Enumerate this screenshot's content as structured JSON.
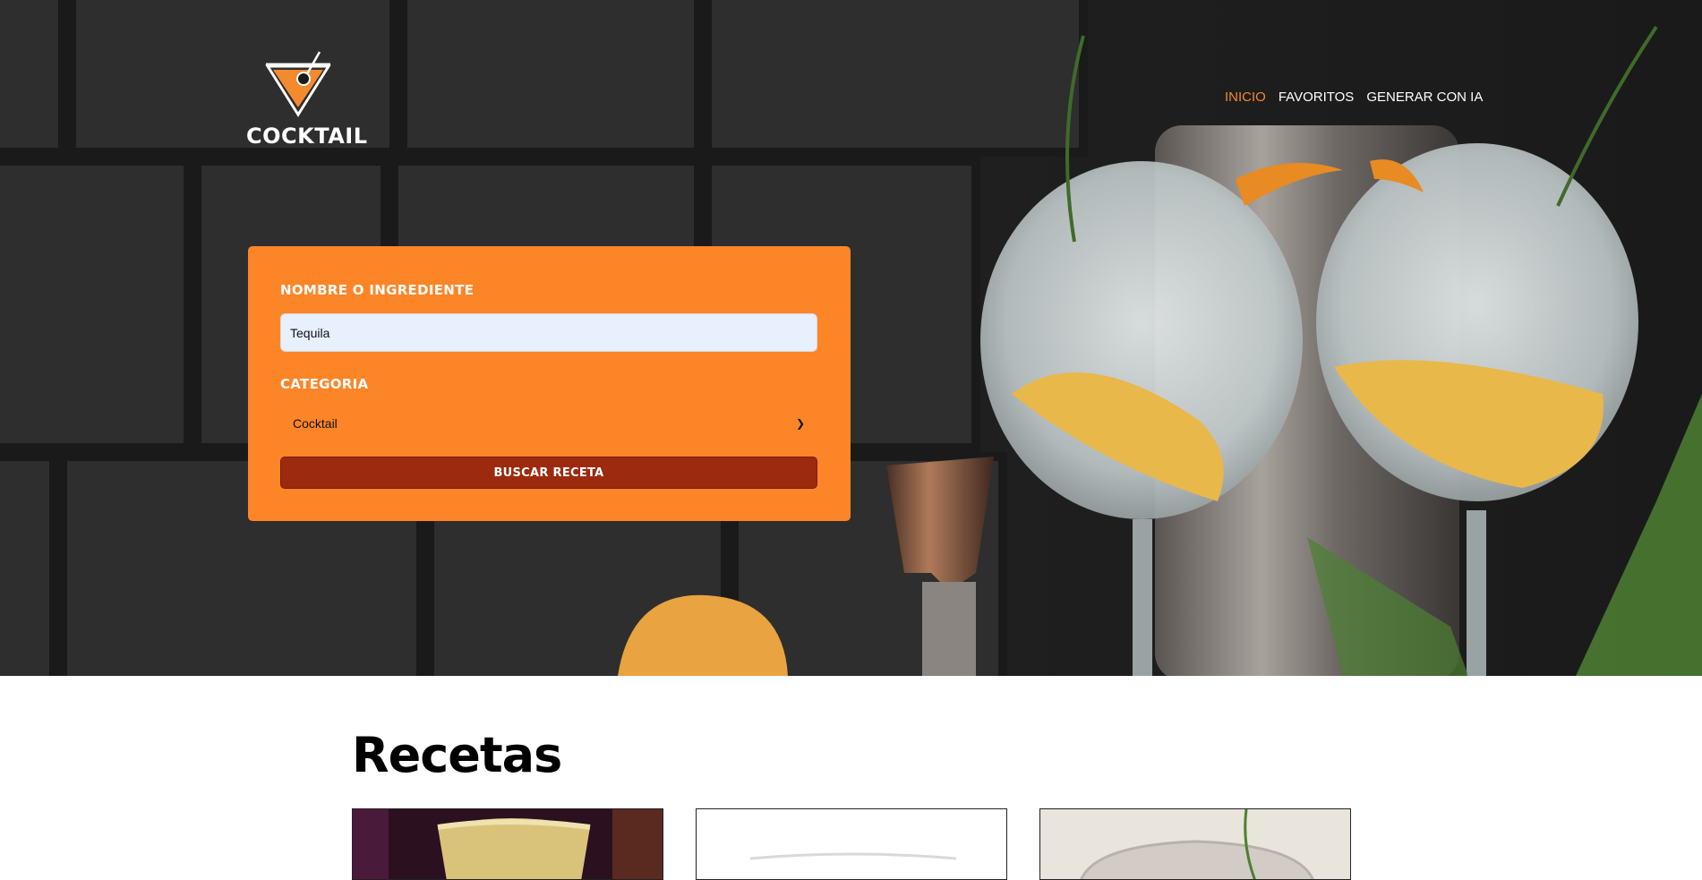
{
  "header": {
    "logo_text": "COCKTAIL",
    "nav": [
      {
        "label": "INICIO",
        "active": true
      },
      {
        "label": "FAVORITOS",
        "active": false
      },
      {
        "label": "GENERAR CON IA",
        "active": false
      }
    ]
  },
  "search": {
    "name_label": "NOMBRE O INGREDIENTE",
    "name_value": "Tequila",
    "category_label": "CATEGORIA",
    "category_value": "Cocktail",
    "submit_label": "BUSCAR RECETA"
  },
  "recipes": {
    "title": "Recetas"
  },
  "colors": {
    "accent": "#fc8528",
    "button": "#9b2a0e",
    "nav_active": "#f28a2e"
  },
  "icons": [
    "martini-logo-icon",
    "chevron-down-icon"
  ]
}
